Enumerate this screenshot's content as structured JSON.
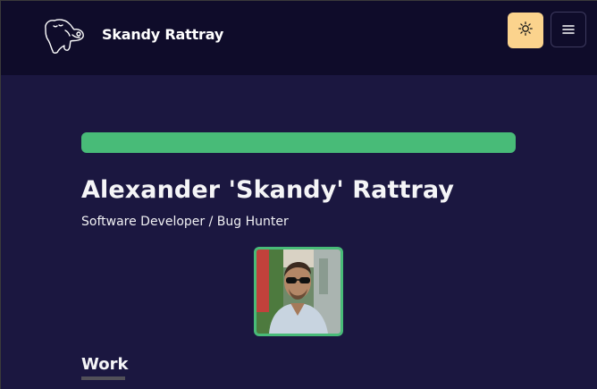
{
  "header": {
    "site_title": "Skandy Rattray",
    "logo_icon": "dog-head-logo-icon",
    "theme_toggle_icon": "sun-icon",
    "menu_icon": "hamburger-menu-icon"
  },
  "hero": {
    "name": "Alexander 'Skandy' Rattray",
    "subtitle": "Software Developer / Bug Hunter",
    "avatar_alt": "profile-photo"
  },
  "sections": {
    "work_heading": "Work"
  },
  "colors": {
    "background": "#1b1740",
    "navbar": "#0f0c2a",
    "accent_green": "#48bb78",
    "theme_toggle": "#fbd38d"
  }
}
